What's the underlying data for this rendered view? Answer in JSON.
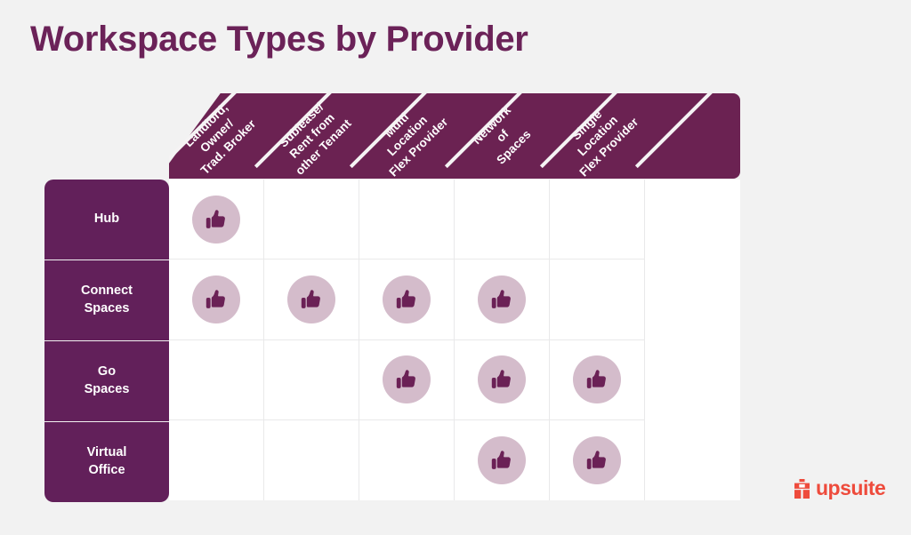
{
  "page": {
    "title": "Workspace Types by Provider",
    "background_color": "#f2f2f2",
    "title_color": "#6b2258"
  },
  "theme": {
    "header_band_color": "#6b2252",
    "row_label_color": "#62205a",
    "grid_background": "#ffffff",
    "grid_line_color": "#e9e9ea",
    "badge_circle_color": "#d4bccb",
    "badge_icon_color": "#6b2156",
    "logo_color": "#ee4b3c"
  },
  "matrix": {
    "columns": [
      {
        "id": "landlord-owner-trad-broker",
        "lines": [
          "Landlord,",
          "Owner/",
          "Trad. Broker"
        ]
      },
      {
        "id": "sublease-rent-from-other-tenant",
        "lines": [
          "Sublease/",
          "Rent from",
          "other Tenant"
        ]
      },
      {
        "id": "multi-location-flex-provider",
        "lines": [
          "Multi",
          "Location",
          "Flex Provider"
        ]
      },
      {
        "id": "network-of-spaces",
        "lines": [
          "Network",
          "of",
          "Spaces"
        ]
      },
      {
        "id": "single-location-flex-provider",
        "lines": [
          "Single",
          "Location",
          "Flex Provider"
        ]
      }
    ],
    "rows": [
      {
        "id": "hub",
        "lines": [
          "Hub"
        ]
      },
      {
        "id": "connect-spaces",
        "lines": [
          "Connect",
          "Spaces"
        ]
      },
      {
        "id": "go-spaces",
        "lines": [
          "Go",
          "Spaces"
        ]
      },
      {
        "id": "virtual-office",
        "lines": [
          "Virtual",
          "Office"
        ]
      }
    ],
    "cells": [
      [
        true,
        false,
        false,
        false,
        false,
        false
      ],
      [
        true,
        true,
        true,
        true,
        false,
        false
      ],
      [
        false,
        false,
        true,
        true,
        true,
        false
      ],
      [
        false,
        false,
        false,
        true,
        true,
        false
      ]
    ],
    "mark_icon": "thumbs-up-icon"
  },
  "logo": {
    "wordmark": "upsuite",
    "mark": "upsuite-mark-icon"
  }
}
